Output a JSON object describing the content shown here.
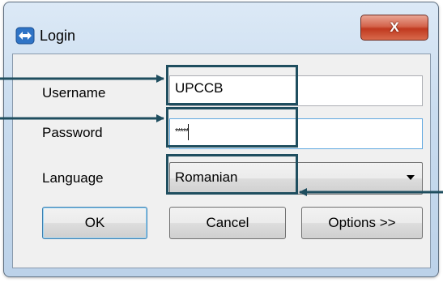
{
  "window": {
    "title": "Login",
    "close_label": "X"
  },
  "form": {
    "username_label": "Username",
    "username_value": "UPCCB",
    "password_label": "Password",
    "password_masked": "*****",
    "language_label": "Language",
    "language_selected": "Romanian"
  },
  "buttons": {
    "ok": "OK",
    "cancel": "Cancel",
    "options": "Options >>"
  },
  "colors": {
    "callout": "#1f4e5f",
    "close_button": "#c0391f"
  }
}
